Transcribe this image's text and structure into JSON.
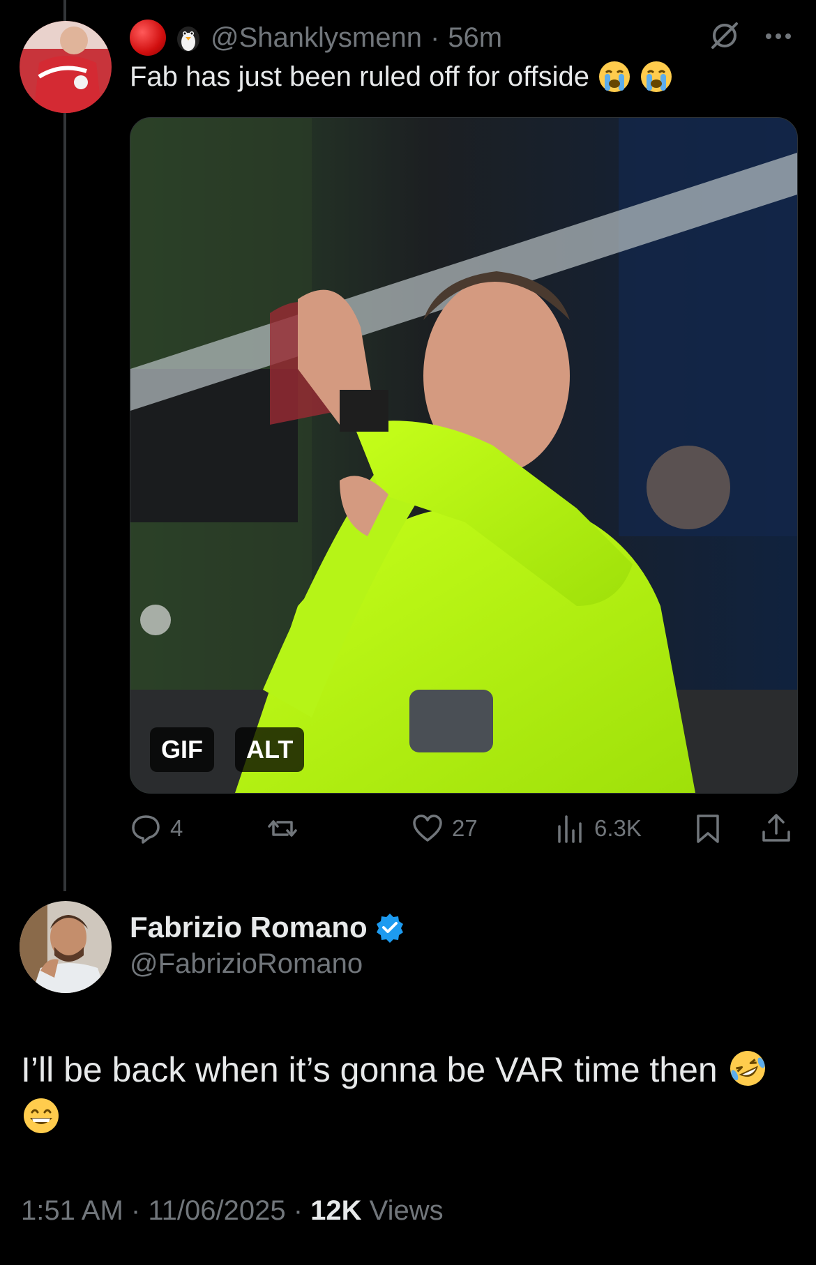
{
  "reply_to": {
    "handle": "@Shanklysmenn",
    "separator": "·",
    "time": "56m",
    "text": "Fab has just been ruled off for offside",
    "emoji_icons": [
      "loudly-crying-face-icon",
      "loudly-crying-face-icon"
    ],
    "media": {
      "badges": [
        "GIF",
        "ALT"
      ]
    },
    "actions": {
      "replies": "4",
      "retweets": "",
      "likes": "27",
      "views": "6.3K"
    }
  },
  "tweet": {
    "name": "Fabrizio Romano",
    "handle": "@FabrizioRomano",
    "text": "I’ll be back when it’s gonna be VAR time then",
    "emoji_icons": [
      "rolling-on-floor-laughing-icon",
      "grinning-face-icon"
    ],
    "time": "1:51 AM",
    "date": "11/06/2025",
    "meta_separator": "·",
    "views_count": "12K",
    "views_label": "Views"
  },
  "colors": {
    "background": "#000000",
    "text_primary": "#e7e9ea",
    "text_secondary": "#71767b",
    "verified_blue": "#1d9bf0",
    "referee_shirt": "#c6ff1a"
  }
}
